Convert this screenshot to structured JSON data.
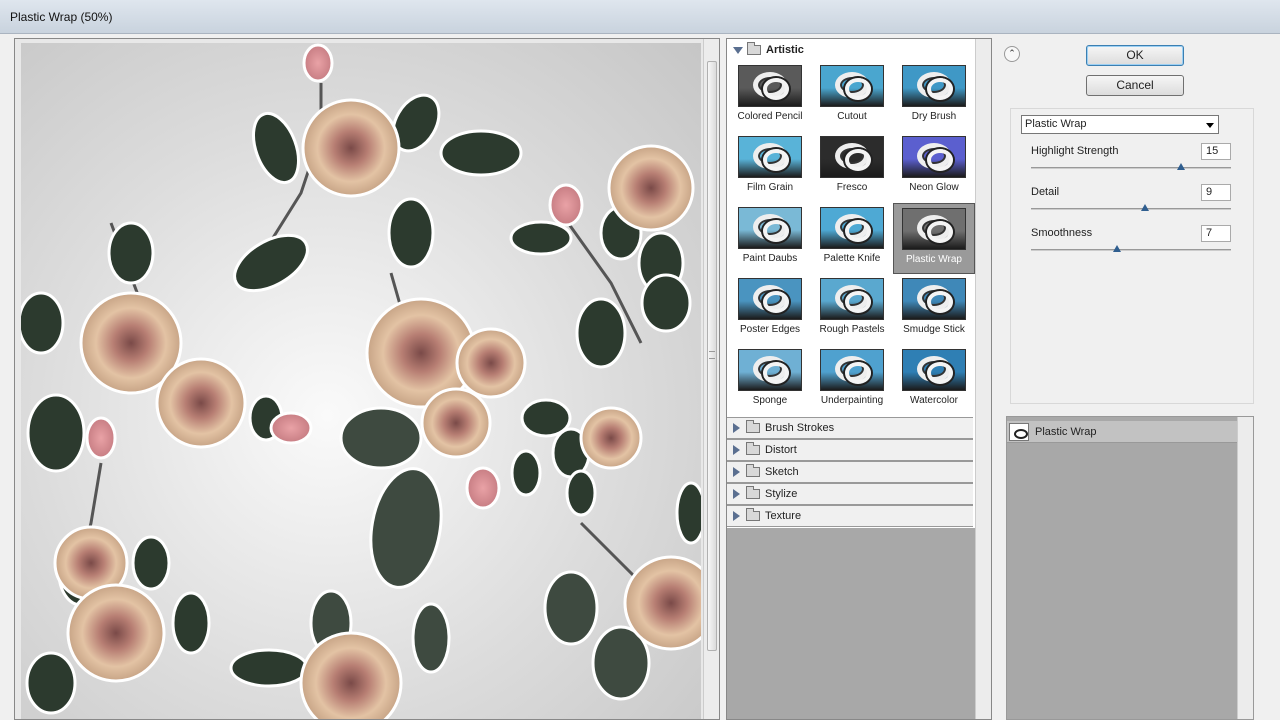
{
  "window": {
    "title": "Plastic Wrap (50%)"
  },
  "buttons": {
    "ok": "OK",
    "cancel": "Cancel",
    "collapse": "⌃"
  },
  "gallery": {
    "category": "Artistic",
    "filters": [
      {
        "label": "Colored Pencil",
        "bg": "#5a5a5a",
        "selected": false
      },
      {
        "label": "Cutout",
        "bg": "#4aa6cf",
        "selected": false
      },
      {
        "label": "Dry Brush",
        "bg": "#3f98c6",
        "selected": false
      },
      {
        "label": "Film Grain",
        "bg": "#59b3d8",
        "selected": false
      },
      {
        "label": "Fresco",
        "bg": "#2c2c2c",
        "selected": false
      },
      {
        "label": "Neon Glow",
        "bg": "#5b5fcf",
        "selected": false
      },
      {
        "label": "Paint Daubs",
        "bg": "#7ab9d6",
        "selected": false
      },
      {
        "label": "Palette Knife",
        "bg": "#4ea9d4",
        "selected": false
      },
      {
        "label": "Plastic Wrap",
        "bg": "#6f6f6f",
        "selected": true
      },
      {
        "label": "Poster Edges",
        "bg": "#4a94c0",
        "selected": false
      },
      {
        "label": "Rough Pastels",
        "bg": "#5aa8cf",
        "selected": false
      },
      {
        "label": "Smudge Stick",
        "bg": "#3f88b8",
        "selected": false
      },
      {
        "label": "Sponge",
        "bg": "#6fb0d4",
        "selected": false
      },
      {
        "label": "Underpainting",
        "bg": "#4fa1cf",
        "selected": false
      },
      {
        "label": "Watercolor",
        "bg": "#2f7fb4",
        "selected": false
      }
    ],
    "other_categories": [
      "Brush Strokes",
      "Distort",
      "Sketch",
      "Stylize",
      "Texture"
    ]
  },
  "settings": {
    "filter_select": "Plastic Wrap",
    "params": [
      {
        "label": "Highlight Strength",
        "value": "15",
        "fraction": 0.75
      },
      {
        "label": "Detail",
        "value": "9",
        "fraction": 0.57
      },
      {
        "label": "Smoothness",
        "value": "7",
        "fraction": 0.43
      }
    ]
  },
  "layers": {
    "items": [
      {
        "name": "Plastic Wrap"
      }
    ]
  }
}
